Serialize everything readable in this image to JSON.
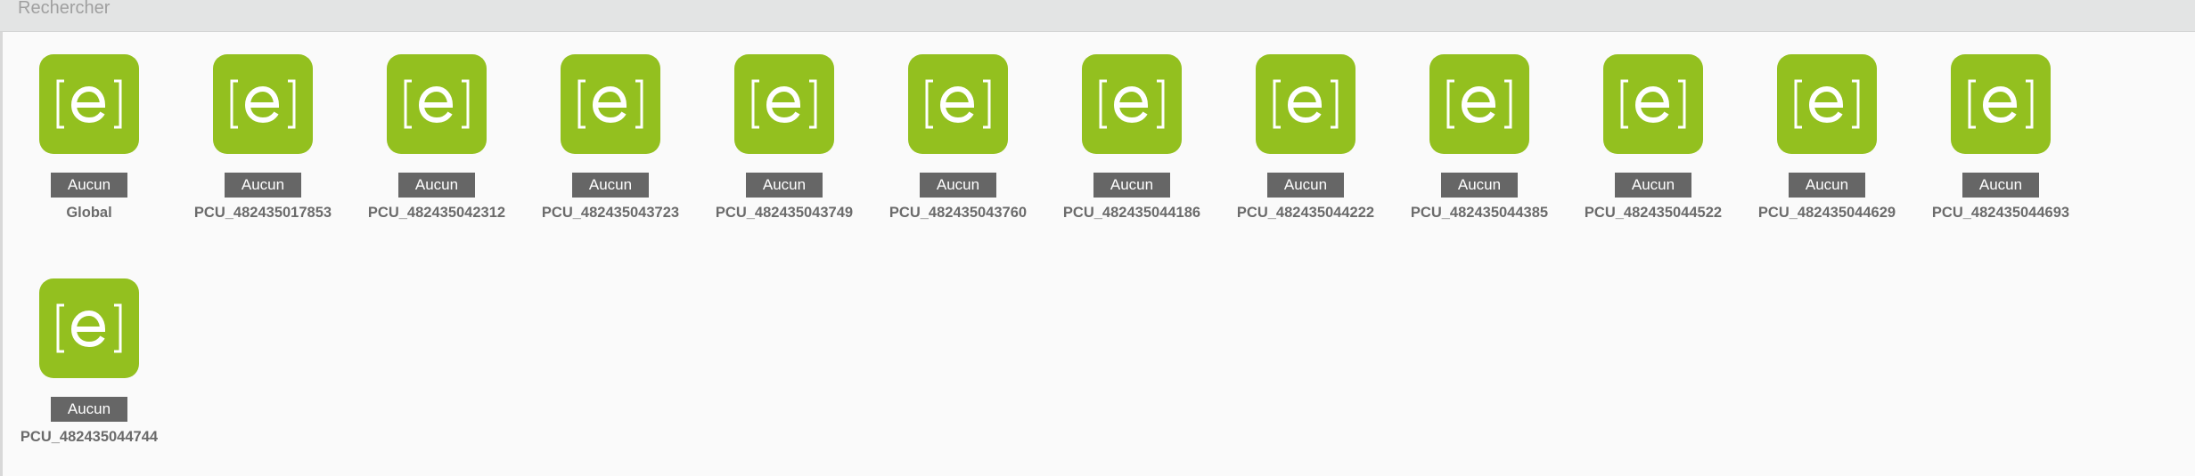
{
  "search": {
    "placeholder": "Rechercher",
    "value": ""
  },
  "items": [
    {
      "badge": "Aucun",
      "name": "Global",
      "icon": "e-logo-icon"
    },
    {
      "badge": "Aucun",
      "name": "PCU_482435017853",
      "icon": "e-logo-icon"
    },
    {
      "badge": "Aucun",
      "name": "PCU_482435042312",
      "icon": "e-logo-icon"
    },
    {
      "badge": "Aucun",
      "name": "PCU_482435043723",
      "icon": "e-logo-icon"
    },
    {
      "badge": "Aucun",
      "name": "PCU_482435043749",
      "icon": "e-logo-icon"
    },
    {
      "badge": "Aucun",
      "name": "PCU_482435043760",
      "icon": "e-logo-icon"
    },
    {
      "badge": "Aucun",
      "name": "PCU_482435044186",
      "icon": "e-logo-icon"
    },
    {
      "badge": "Aucun",
      "name": "PCU_482435044222",
      "icon": "e-logo-icon"
    },
    {
      "badge": "Aucun",
      "name": "PCU_482435044385",
      "icon": "e-logo-icon"
    },
    {
      "badge": "Aucun",
      "name": "PCU_482435044522",
      "icon": "e-logo-icon"
    },
    {
      "badge": "Aucun",
      "name": "PCU_482435044629",
      "icon": "e-logo-icon"
    },
    {
      "badge": "Aucun",
      "name": "PCU_482435044693",
      "icon": "e-logo-icon"
    },
    {
      "badge": "Aucun",
      "name": "PCU_482435044744",
      "icon": "e-logo-icon"
    }
  ],
  "colors": {
    "icon_background": "#93c01f",
    "badge_background": "#666666",
    "name_text": "#6b6b6b",
    "search_bar": "#e3e4e4"
  }
}
